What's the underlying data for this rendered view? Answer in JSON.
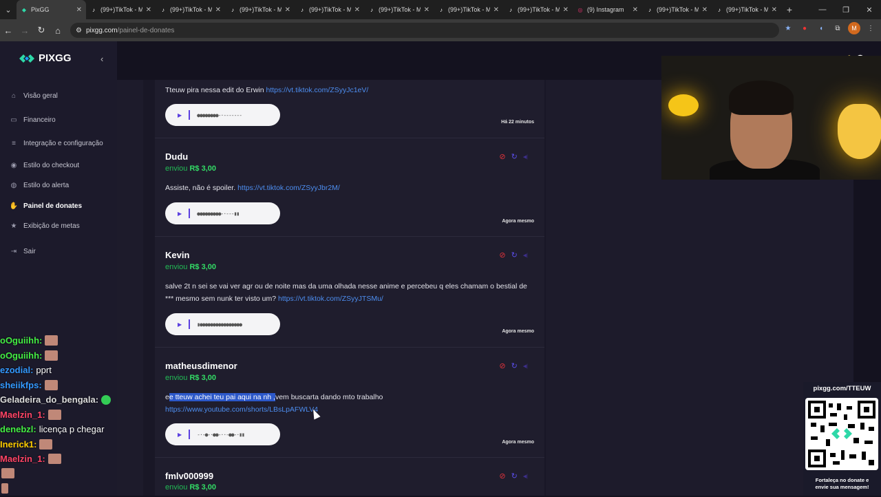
{
  "browser": {
    "tabs": [
      {
        "title": "PixGG",
        "active": true,
        "icon": "pixgg-icon"
      },
      {
        "title": "(99+)TikTok - M",
        "icon": "tiktok-icon"
      },
      {
        "title": "(99+)TikTok - M",
        "icon": "tiktok-icon"
      },
      {
        "title": "(99+)TikTok - M",
        "icon": "tiktok-icon"
      },
      {
        "title": "(99+)TikTok - M",
        "icon": "tiktok-icon"
      },
      {
        "title": "(99+)TikTok - M",
        "icon": "tiktok-icon"
      },
      {
        "title": "(99+)TikTok - M",
        "icon": "tiktok-icon"
      },
      {
        "title": "(99+)TikTok - M",
        "icon": "tiktok-icon"
      },
      {
        "title": "(9) Instagram",
        "icon": "instagram-icon"
      },
      {
        "title": "(99+)TikTok - M",
        "icon": "tiktok-icon"
      },
      {
        "title": "(99+)TikTok - M",
        "icon": "tiktok-icon"
      }
    ],
    "url_host": "pixgg.com",
    "url_path": "/painel-de-donates",
    "profile_initial": "M"
  },
  "sidebar": {
    "brand": "PIXGG",
    "items": [
      {
        "label": "Visão geral",
        "icon": "home-icon"
      },
      {
        "label": "Financeiro",
        "icon": "wallet-icon"
      },
      {
        "label": "Integração e configuração",
        "icon": "settings-icon"
      },
      {
        "label": "Estilo do checkout",
        "icon": "palette-icon"
      },
      {
        "label": "Estilo do alerta",
        "icon": "alert-icon"
      },
      {
        "label": "Painel de donates",
        "icon": "hand-coin-icon",
        "active": true
      },
      {
        "label": "Exibição de metas",
        "icon": "star-icon"
      },
      {
        "label": "Sair",
        "icon": "logout-icon"
      }
    ]
  },
  "donations": [
    {
      "name": "",
      "message_prefix": "Tteuw pira nessa edit do Erwin ",
      "link": "https://vt.tiktok.com/ZSyyJc1eV/",
      "time": "Há 22 minutos"
    },
    {
      "name": "Dudu",
      "sent": "enviou",
      "amount": "R$ 3,00",
      "message_prefix": "Assiste, não é spoiler. ",
      "link": "https://vt.tiktok.com/ZSyyJbr2M/",
      "time": "Agora mesmo"
    },
    {
      "name": "Kevin",
      "sent": "enviou",
      "amount": "R$ 3,00",
      "message_prefix": "salve 2t n sei se vai ver agr ou de noite mas da uma olhada nesse anime e percebeu q eles chamam o bestial de *** mesmo sem nunk ter visto um? ",
      "link": "https://vt.tiktok.com/ZSyyJTSMu/",
      "time": "Agora mesmo"
    },
    {
      "name": "matheusdimenor",
      "sent": "enviou",
      "amount": "R$ 3,00",
      "message_start": "e",
      "message_selected": "e tteuw achei teu pai aqui na nh ,",
      "message_rest": "vem buscarta dando mto trabalho",
      "link": "https://www.youtube.com/shorts/LBsLpAFWLV4",
      "time": "Agora mesmo"
    },
    {
      "name": "fmlv000999",
      "sent": "enviou",
      "amount": "R$ 3,00"
    }
  ],
  "chat": [
    {
      "user": "oOguiihh:",
      "color": "#44ee44",
      "text": "",
      "emote": true
    },
    {
      "user": "oOguiihh:",
      "color": "#44ee44",
      "text": "",
      "emote": true
    },
    {
      "user": "ezodial:",
      "color": "#3399ff",
      "text": "pprt"
    },
    {
      "user": "sheiikfps:",
      "color": "#3399ff",
      "text": "",
      "emote": true
    },
    {
      "user": "Geladeira_do_bengala:",
      "color": "#dddddd",
      "text": "",
      "emote_green": true
    },
    {
      "user": "Maelzin_1:",
      "color": "#ff4466",
      "text": "",
      "emote": true
    },
    {
      "user": "denebzl:",
      "color": "#44ee44",
      "text": "licença p chegar"
    },
    {
      "user": "Inerick1:",
      "color": "#ffcc00",
      "text": "",
      "emote": true
    },
    {
      "user": "Maelzin_1:",
      "color": "#ff4466",
      "text": "",
      "emote": true
    }
  ],
  "qr": {
    "title": "pixgg.com/TTEUW",
    "footer_line1": "Fortaleça no donate e",
    "footer_line2": "envie sua mensagem!"
  },
  "colors": {
    "accent": "#5a4de8",
    "amount": "#33dd66",
    "link": "#4d8ef0",
    "block": "#e0333a"
  }
}
